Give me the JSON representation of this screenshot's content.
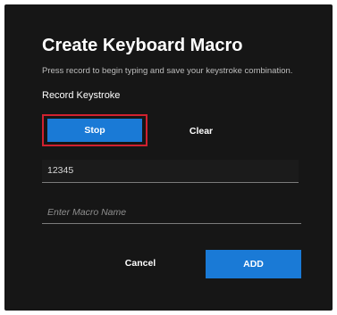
{
  "dialog": {
    "title": "Create Keyboard Macro",
    "subtitle": "Press record to begin typing and save your keystroke combination.",
    "section_label": "Record Keystroke",
    "record": {
      "stop_label": "Stop",
      "clear_label": "Clear"
    },
    "keystroke_value": "12345",
    "macro_name": {
      "value": "",
      "placeholder": "Enter Macro Name"
    },
    "actions": {
      "cancel_label": "Cancel",
      "add_label": "ADD"
    }
  },
  "colors": {
    "background": "#161616",
    "accent": "#1a7ad6",
    "focus_outline": "#d0212f"
  }
}
